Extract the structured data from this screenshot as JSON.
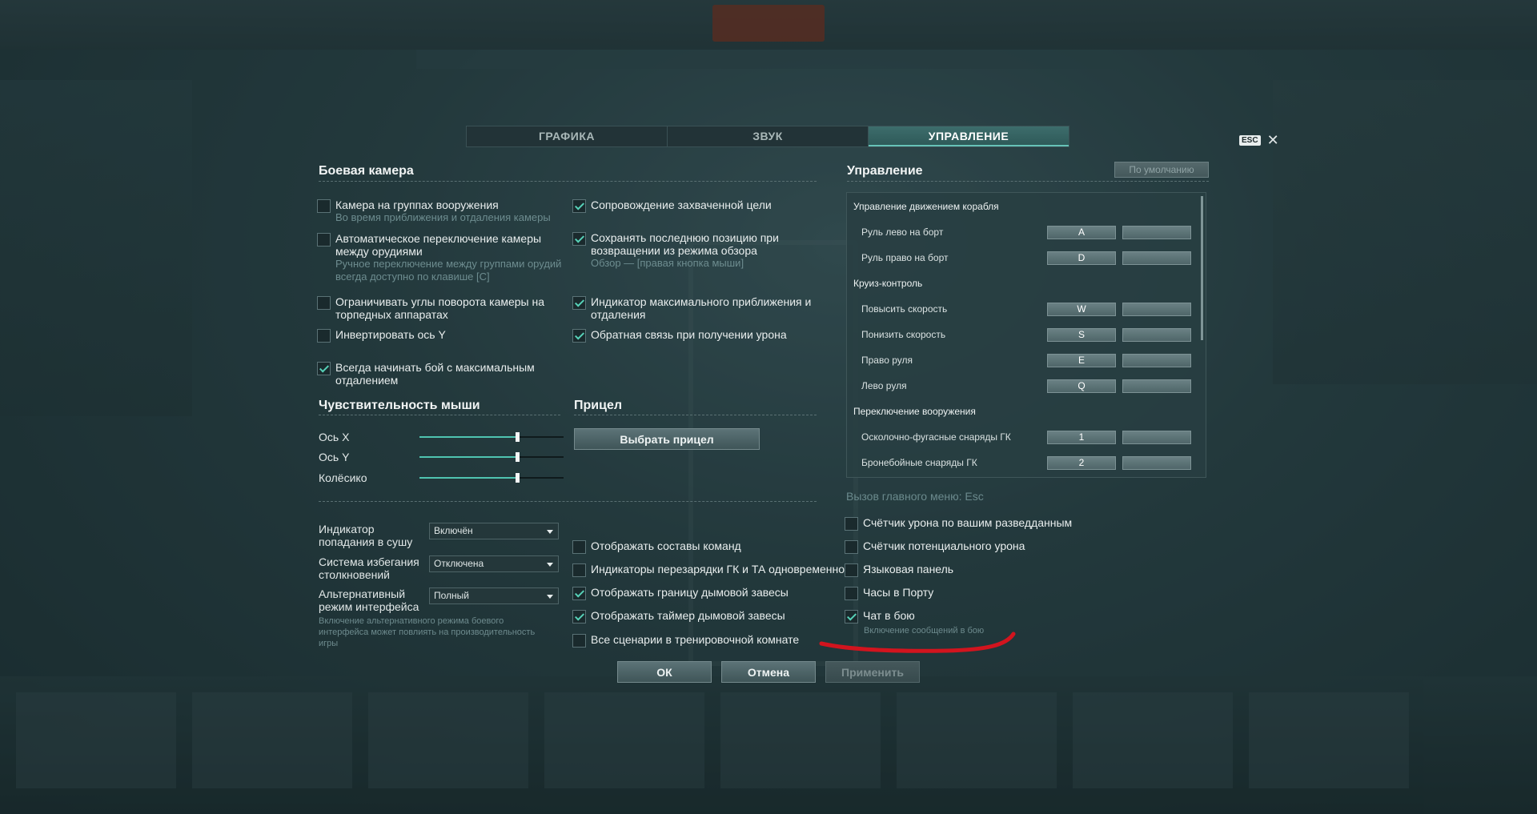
{
  "tabs": [
    "ГРАФИКА",
    "ЗВУК",
    "УПРАВЛЕНИЕ"
  ],
  "esc_badge": "ESC",
  "close_glyph": "✕",
  "battle_camera": {
    "title": "Боевая камера",
    "left": [
      {
        "label": "Камера на группах вооружения",
        "sub": "Во время приближения и отдаления камеры",
        "checked": false
      },
      {
        "label": "Автоматическое переключение камеры между орудиями",
        "sub": "Ручное переключение между группами орудий всегда доступно по клавише [C]",
        "checked": false
      },
      {
        "label": "Ограничивать углы поворота камеры на торпедных аппаратах",
        "sub": "",
        "checked": false
      },
      {
        "label": "Инвертировать ось Y",
        "sub": "",
        "checked": false
      },
      {
        "label": "Всегда начинать бой с максимальным отдалением",
        "sub": "",
        "checked": true
      }
    ],
    "right": [
      {
        "label": "Сопровождение захваченной цели",
        "sub": "",
        "checked": true
      },
      {
        "label": "Сохранять последнюю позицию при возвращении из режима обзора",
        "sub": "Обзор — [правая кнопка мыши]",
        "checked": true
      },
      {
        "label": "Индикатор максимального приближения и отдаления",
        "sub": "",
        "checked": true
      },
      {
        "label": "Обратная связь при получении урона",
        "sub": "",
        "checked": true
      }
    ]
  },
  "mouse": {
    "title": "Чувствительность мыши",
    "sliders": [
      {
        "label": "Ось X",
        "value": 0.68
      },
      {
        "label": "Ось Y",
        "value": 0.68
      },
      {
        "label": "Колёсико",
        "value": 0.68
      }
    ]
  },
  "sight": {
    "title": "Прицел",
    "button": "Выбрать прицел"
  },
  "selects": [
    {
      "label": "Индикатор попадания в сушу",
      "value": "Включён"
    },
    {
      "label": "Система избегания столкновений",
      "value": "Отключена"
    },
    {
      "label": "Альтернативный режим интерфейса",
      "value": "Полный"
    }
  ],
  "alt_note": "Включение альтернативного режима боевого интерфейса может повлиять на производительность игры",
  "middle_checks": [
    {
      "label": "Отображать составы команд",
      "checked": false
    },
    {
      "label": "Индикаторы перезарядки ГК и ТА одновременно",
      "checked": false
    },
    {
      "label": "Отображать границу дымовой завесы",
      "checked": true
    },
    {
      "label": "Отображать таймер дымовой завесы",
      "checked": true
    },
    {
      "label": "Все сценарии в тренировочной комнате",
      "checked": false
    }
  ],
  "controls": {
    "title": "Управление",
    "default_button": "По умолчанию",
    "groups": [
      {
        "name": "Управление движением корабля",
        "rows": [
          {
            "label": "Руль лево на борт",
            "key": "A"
          },
          {
            "label": "Руль право на борт",
            "key": "D"
          }
        ]
      },
      {
        "name": "Круиз-контроль",
        "rows": [
          {
            "label": "Повысить скорость",
            "key": "W"
          },
          {
            "label": "Понизить скорость",
            "key": "S"
          },
          {
            "label": "Право руля",
            "key": "E"
          },
          {
            "label": "Лево руля",
            "key": "Q"
          }
        ]
      },
      {
        "name": "Переключение вооружения",
        "rows": [
          {
            "label": "Осколочно-фугасные снаряды ГК",
            "key": "1"
          },
          {
            "label": "Бронебойные снаряды ГК",
            "key": "2"
          }
        ]
      }
    ],
    "menu_hint": "Вызов главного меню: Esc"
  },
  "right_checks": [
    {
      "label": "Счётчик урона по вашим разведданным",
      "checked": false
    },
    {
      "label": "Счётчик потенциального урона",
      "checked": false
    },
    {
      "label": "Языковая панель",
      "checked": false
    },
    {
      "label": "Часы в Порту",
      "checked": false
    },
    {
      "label": "Чат в бою",
      "checked": true
    }
  ],
  "chat_sub": "Включение сообщений в бою",
  "footer": {
    "ok": "ОК",
    "cancel": "Отмена",
    "apply": "Применить"
  },
  "colors": {
    "accent": "#57d2b8",
    "annotation": "#d2141e"
  }
}
